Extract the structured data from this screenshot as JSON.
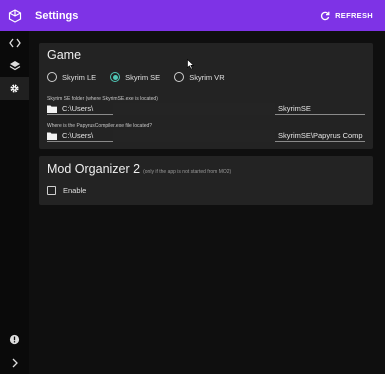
{
  "header": {
    "title": "Settings",
    "refresh_label": "REFRESH"
  },
  "rail": {
    "items": [
      "code-icon",
      "layers-icon",
      "gear-icon"
    ],
    "bottom": [
      "alert-icon",
      "chevron-right-icon"
    ]
  },
  "game": {
    "title": "Game",
    "options": [
      {
        "label": "Skyrim LE",
        "checked": false
      },
      {
        "label": "Skyrim SE",
        "checked": true
      },
      {
        "label": "Skyrim VR",
        "checked": false
      }
    ],
    "folder_label": "Skyrim SE folder (where SkyrimSE.exe is located)",
    "folder_value_start": "C:\\Users\\",
    "folder_value_end": "SkyrimSE",
    "compiler_label": "Where is the PapyrusCompiler.exe file located?",
    "compiler_value_start": "C:\\Users\\",
    "compiler_value_end": "SkyrimSE\\Papyrus Comp"
  },
  "mo2": {
    "title": "Mod Organizer 2",
    "note": "(only if the app is not started from MO2)",
    "enable_label": "Enable"
  },
  "colors": {
    "accent": "#7e33e6",
    "radio": "#4fc7b6",
    "card": "#232323",
    "bg": "#0f0f0f"
  }
}
